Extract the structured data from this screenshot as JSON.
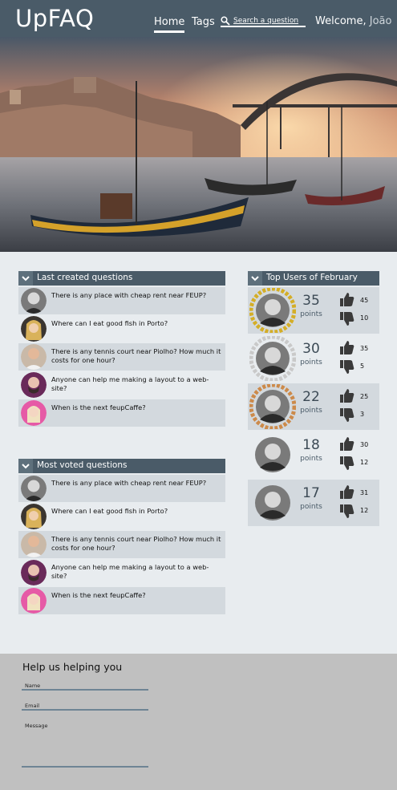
{
  "header": {
    "logo": "UpFAQ",
    "nav": [
      {
        "label": "Home",
        "active": true
      },
      {
        "label": "Tags",
        "active": false
      }
    ],
    "search": {
      "label": "Search a question",
      "icon": "search-icon"
    },
    "welcome": {
      "prefix": "Welcome,",
      "user": "João"
    },
    "colors": {
      "bar": "#4a5b68",
      "accent": "#ffffff"
    }
  },
  "last_created": {
    "title": "Last created questions",
    "items": [
      {
        "text": "There is any place with cheap rent near FEUP?",
        "avatar": "avatar-man-1"
      },
      {
        "text": "Where can I eat good fish in Porto?",
        "avatar": "avatar-woman-1"
      },
      {
        "text": "There is any tennis court near Piolho? How much it costs for one hour?",
        "avatar": "avatar-man-2"
      },
      {
        "text": "Anyone can help me making a layout to a web-site?",
        "avatar": "avatar-man-3"
      },
      {
        "text": "When is the next feupCaffe?",
        "avatar": "avatar-woman-2"
      }
    ]
  },
  "most_voted": {
    "title": "Most voted questions",
    "items": [
      {
        "text": "There is any place with cheap rent near FEUP?",
        "avatar": "avatar-man-1"
      },
      {
        "text": "Where can I eat good fish in Porto?",
        "avatar": "avatar-woman-1"
      },
      {
        "text": "There is any tennis court near Piolho? How much it costs for one hour?",
        "avatar": "avatar-man-2"
      },
      {
        "text": "Anyone can help me making a layout to a web-site?",
        "avatar": "avatar-man-3"
      },
      {
        "text": "When is the next feupCaffe?",
        "avatar": "avatar-woman-2"
      }
    ]
  },
  "top_users": {
    "title": "Top Users of February",
    "users": [
      {
        "points": "35",
        "points_label": "points",
        "up": "45",
        "down": "10",
        "medal": "gold",
        "medal_color": "#d4ae27"
      },
      {
        "points": "30",
        "points_label": "points",
        "up": "35",
        "down": "5",
        "medal": "silver",
        "medal_color": "#c9c9c9"
      },
      {
        "points": "22",
        "points_label": "points",
        "up": "25",
        "down": "3",
        "medal": "bronze",
        "medal_color": "#cc8a4a"
      },
      {
        "points": "18",
        "points_label": "points",
        "up": "30",
        "down": "12",
        "medal": "none",
        "medal_color": ""
      },
      {
        "points": "17",
        "points_label": "points",
        "up": "31",
        "down": "12",
        "medal": "none",
        "medal_color": ""
      }
    ]
  },
  "footer": {
    "title": "Help us helping you",
    "fields": {
      "name": "Name",
      "email": "Email",
      "message": "Message"
    }
  }
}
